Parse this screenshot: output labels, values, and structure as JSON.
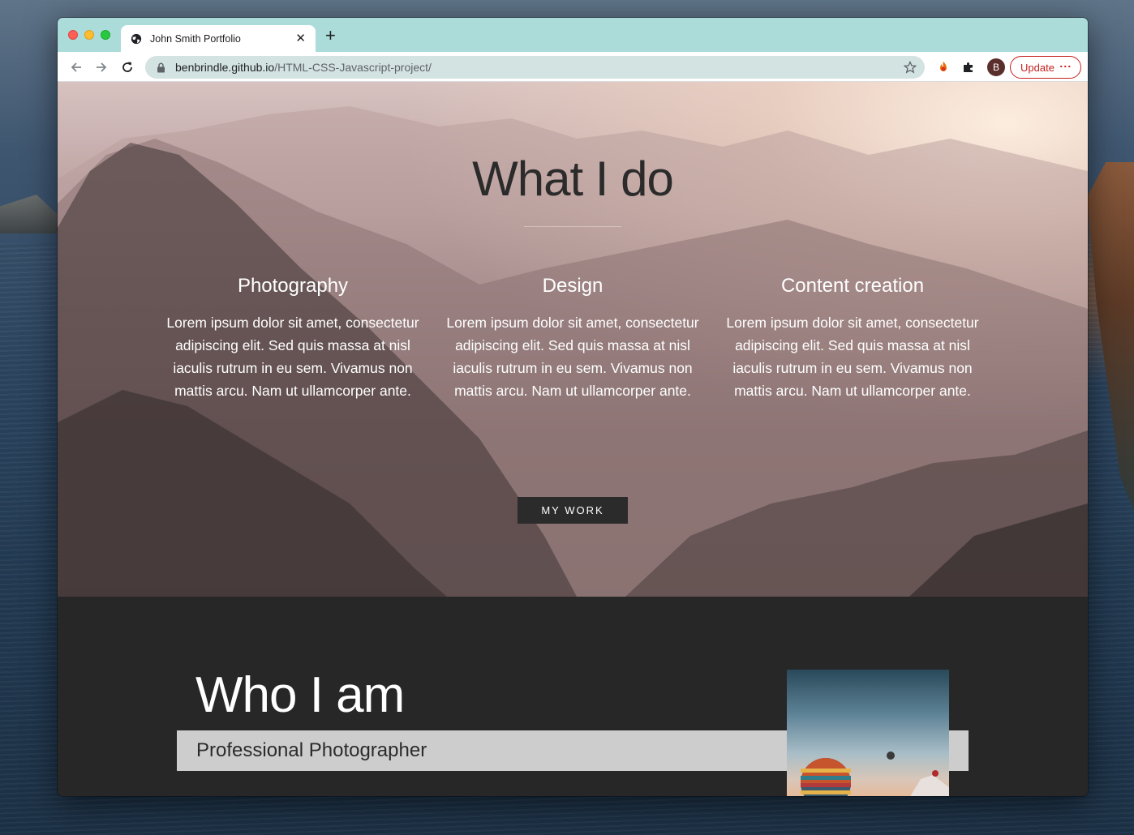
{
  "browser": {
    "tab_title": "John Smith Portfolio",
    "new_tab": "+",
    "close_tab": "✕",
    "url_host": "benbrindle.github.io",
    "url_path": "/HTML-CSS-Javascript-project/",
    "profile_initial": "B",
    "update_label": "Update",
    "menu_dots": "⋮"
  },
  "hero": {
    "title": "What I do",
    "services": [
      {
        "title": "Photography",
        "text": "Lorem ipsum dolor sit amet, consectetur adipiscing elit. Sed quis massa at nisl iaculis rutrum in eu sem. Vivamus non mattis arcu. Nam ut ullamcorper ante."
      },
      {
        "title": "Design",
        "text": "Lorem ipsum dolor sit amet, consectetur adipiscing elit. Sed quis massa at nisl iaculis rutrum in eu sem. Vivamus non mattis arcu. Nam ut ullamcorper ante."
      },
      {
        "title": "Content creation",
        "text": "Lorem ipsum dolor sit amet, consectetur adipiscing elit. Sed quis massa at nisl iaculis rutrum in eu sem. Vivamus non mattis arcu. Nam ut ullamcorper ante."
      }
    ],
    "button_label": "MY WORK"
  },
  "about": {
    "title": "Who I am",
    "subtitle": "Professional Photographer"
  },
  "colors": {
    "tab_strip": "#abdcd9",
    "omnibox": "#d3e3e2",
    "update_accent": "#c5221f",
    "dark_section": "#272727",
    "button_bg": "#2b2b2b"
  },
  "icons": {
    "tab": "globe-icon",
    "back": "arrow-left-icon",
    "forward": "arrow-right-icon",
    "reload": "reload-icon",
    "lock": "lock-icon",
    "bookmark": "star-icon",
    "extension_1": "flame-extension-icon",
    "extension_2": "puzzle-icon"
  }
}
